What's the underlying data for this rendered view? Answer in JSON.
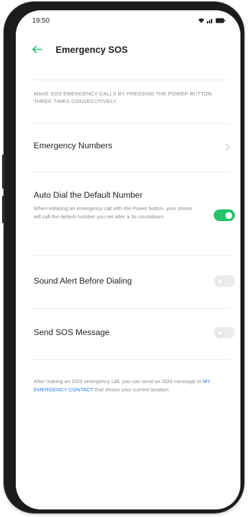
{
  "status_bar": {
    "time": "19:50",
    "icons": [
      "wifi-icon",
      "signal-icon",
      "battery-icon"
    ]
  },
  "header": {
    "back_icon": "arrow-left-icon",
    "title": "Emergency SOS"
  },
  "description": "MAKE SOS EMERGENCY CALLS BY PRESSING THE POWER BUTTON THREE TIMES CONSECUTIVELY.",
  "settings": [
    {
      "label": "Emergency Numbers",
      "control": "chevron-right-icon"
    },
    {
      "label": "Auto Dial the Default Number",
      "sub": "When initiating an emergency call with the Power button, your phone will call the default number you set after a 3s countdown.",
      "toggle_on": true
    },
    {
      "label": "Sound Alert Before Dialing",
      "toggle_on": false
    },
    {
      "label": "Send SOS Message",
      "toggle_on": false
    }
  ],
  "footer": {
    "text_before": "After making an SOS emergency call, you can send an SOS message to ",
    "link": "MY EMERGENCY CONTACT",
    "text_after": " that shows your current location."
  },
  "colors": {
    "accent_green": "#27c36b",
    "link_blue": "#2f80e8",
    "back_arrow": "#27c36b"
  }
}
